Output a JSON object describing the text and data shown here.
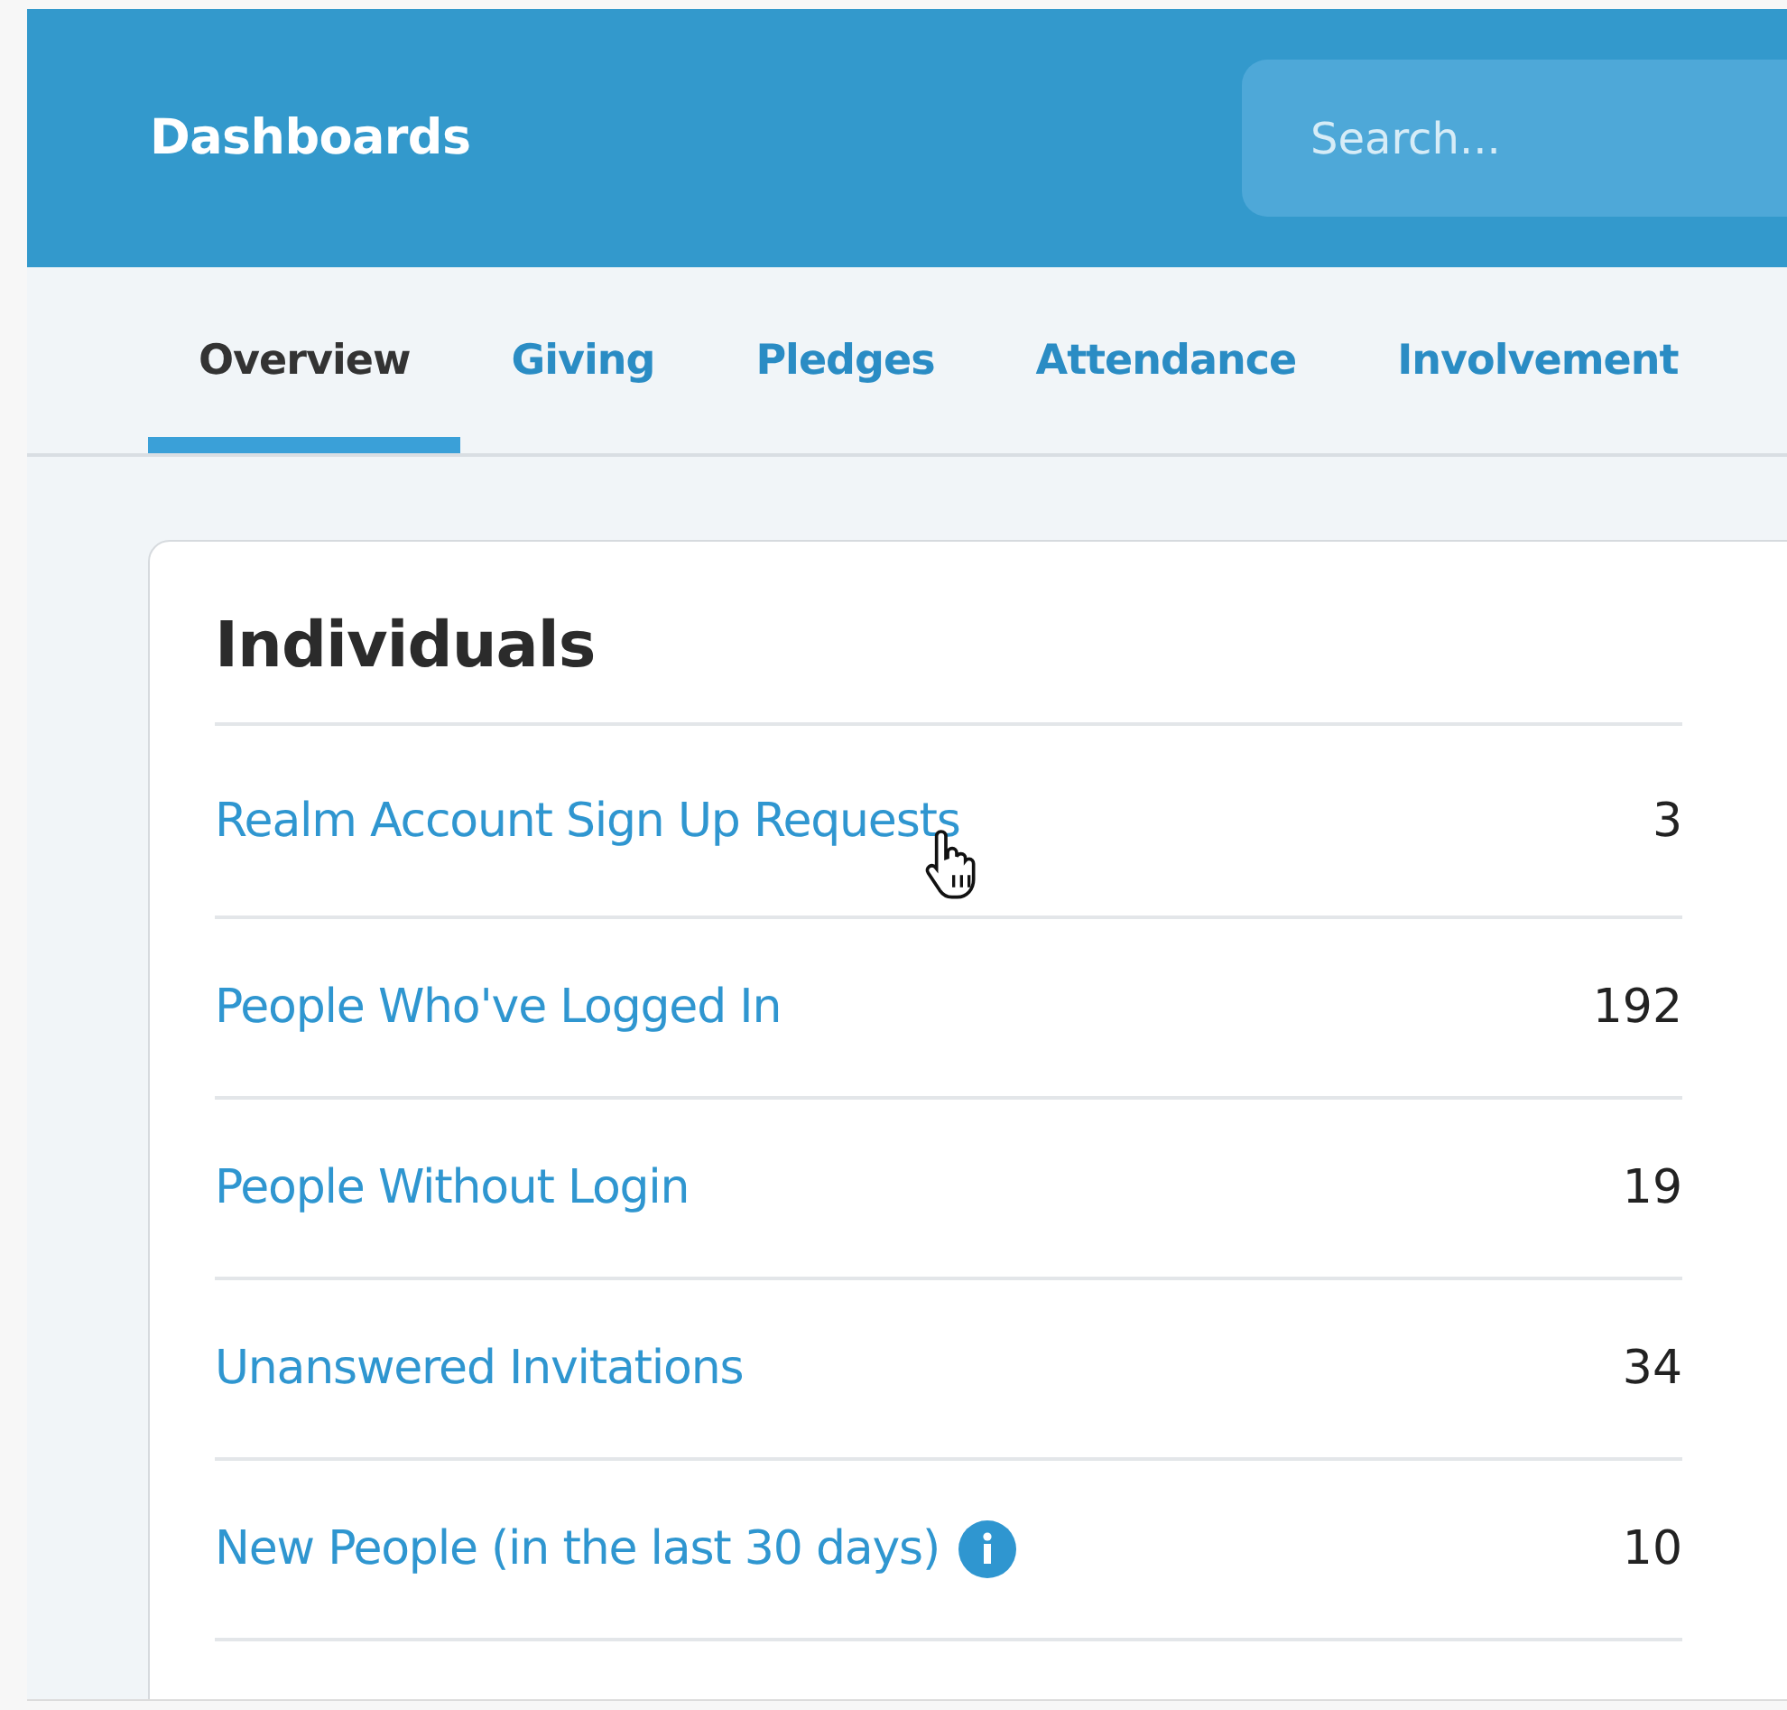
{
  "header": {
    "title": "Dashboards",
    "search": {
      "placeholder": "Search..."
    }
  },
  "tabs": [
    {
      "label": "Overview",
      "selected": true
    },
    {
      "label": "Giving",
      "selected": false
    },
    {
      "label": "Pledges",
      "selected": false
    },
    {
      "label": "Attendance",
      "selected": false
    },
    {
      "label": "Involvement",
      "selected": false
    }
  ],
  "card": {
    "title": "Individuals",
    "rows": [
      {
        "label": "Realm Account Sign Up Requests",
        "count": "3",
        "info": false
      },
      {
        "label": "People Who've Logged In",
        "count": "192",
        "info": false
      },
      {
        "label": "People Without Login",
        "count": "19",
        "info": false
      },
      {
        "label": "Unanswered Invitations",
        "count": "34",
        "info": false
      },
      {
        "label": "New People (in the last 30 days)",
        "count": "10",
        "info": true
      }
    ]
  }
}
